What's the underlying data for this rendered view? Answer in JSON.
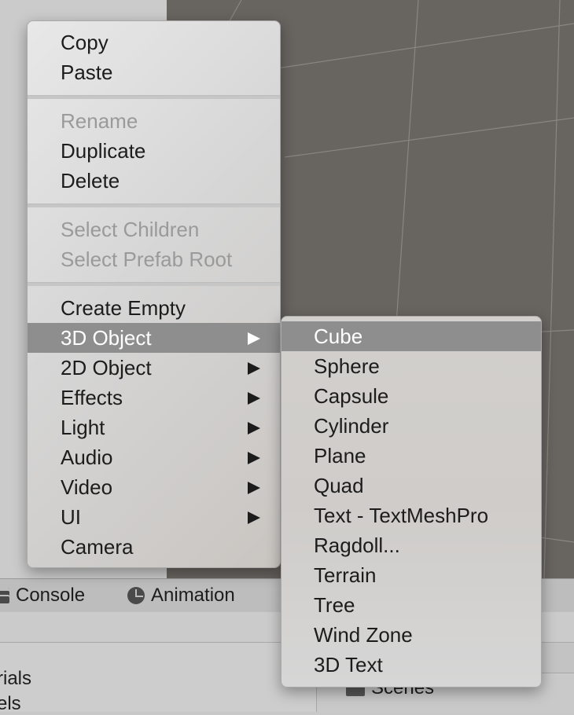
{
  "main_menu": {
    "items": [
      {
        "label": "Copy",
        "state": "enabled"
      },
      {
        "label": "Paste",
        "state": "enabled"
      },
      {
        "label": "Rename",
        "state": "disabled"
      },
      {
        "label": "Duplicate",
        "state": "enabled"
      },
      {
        "label": "Delete",
        "state": "enabled"
      },
      {
        "label": "Select Children",
        "state": "disabled"
      },
      {
        "label": "Select Prefab Root",
        "state": "disabled"
      },
      {
        "label": "Create Empty",
        "state": "enabled"
      },
      {
        "label": "3D Object",
        "state": "highlighted",
        "submenu": true
      },
      {
        "label": "2D Object",
        "state": "enabled",
        "submenu": true
      },
      {
        "label": "Effects",
        "state": "enabled",
        "submenu": true
      },
      {
        "label": "Light",
        "state": "enabled",
        "submenu": true
      },
      {
        "label": "Audio",
        "state": "enabled",
        "submenu": true
      },
      {
        "label": "Video",
        "state": "enabled",
        "submenu": true
      },
      {
        "label": "UI",
        "state": "enabled",
        "submenu": true
      },
      {
        "label": "Camera",
        "state": "enabled"
      }
    ]
  },
  "submenu_3d_object": {
    "items": [
      {
        "label": "Cube",
        "state": "highlighted"
      },
      {
        "label": "Sphere",
        "state": "enabled"
      },
      {
        "label": "Capsule",
        "state": "enabled"
      },
      {
        "label": "Cylinder",
        "state": "enabled"
      },
      {
        "label": "Plane",
        "state": "enabled"
      },
      {
        "label": "Quad",
        "state": "enabled"
      },
      {
        "label": "Text - TextMeshPro",
        "state": "enabled"
      },
      {
        "label": "Ragdoll...",
        "state": "enabled"
      },
      {
        "label": "Terrain",
        "state": "enabled"
      },
      {
        "label": "Tree",
        "state": "enabled"
      },
      {
        "label": "Wind Zone",
        "state": "enabled"
      },
      {
        "label": "3D Text",
        "state": "enabled"
      }
    ]
  },
  "bottom_tabs": {
    "console_label": "Console",
    "animation_label": "Animation"
  },
  "project_panel": {
    "left_items": [
      "rials",
      "els"
    ],
    "folder_label": "Scenes"
  },
  "colors": {
    "highlight": "#8e8e8e",
    "scene_background": "#686460",
    "disabled_text": "#9a9a9a"
  }
}
